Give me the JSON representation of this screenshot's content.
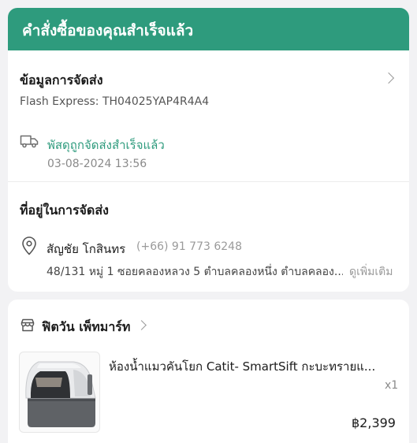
{
  "banner": {
    "title": "คำสั่งซื้อของคุณสำเร็จแล้ว"
  },
  "shipping": {
    "section_title": "ข้อมูลการจัดส่ง",
    "carrier_tracking": "Flash Express: TH04025YAP4R4A4",
    "status": "พัสดุถูกจัดส่งสำเร็จแล้ว",
    "timestamp": "03-08-2024 13:56"
  },
  "address": {
    "section_title": "ที่อยู่ในการจัดส่ง",
    "name": "สัญชัย โกสินทร",
    "phone": "(+66) 91 773 6248",
    "line": "48/131 หมู่ 1 ซอยคลองหลวง 5 ตำบลคลองหนึ่ง ตำบลคลอง...",
    "see_more": "ดูเพิ่มเติม"
  },
  "shop": {
    "name": "ฟิตวัน เพ็ทมาร์ท"
  },
  "product": {
    "title": "ห้องน้ำแมวคันโยก Catit- SmartSift กะบะทรายแ...",
    "quantity": "x1",
    "price": "฿2,399"
  },
  "colors": {
    "brand": "#2e9b7d",
    "background": "#f2f2f4"
  },
  "icons": [
    "truck-icon",
    "location-pin-icon",
    "store-icon",
    "chevron-right-icon"
  ]
}
